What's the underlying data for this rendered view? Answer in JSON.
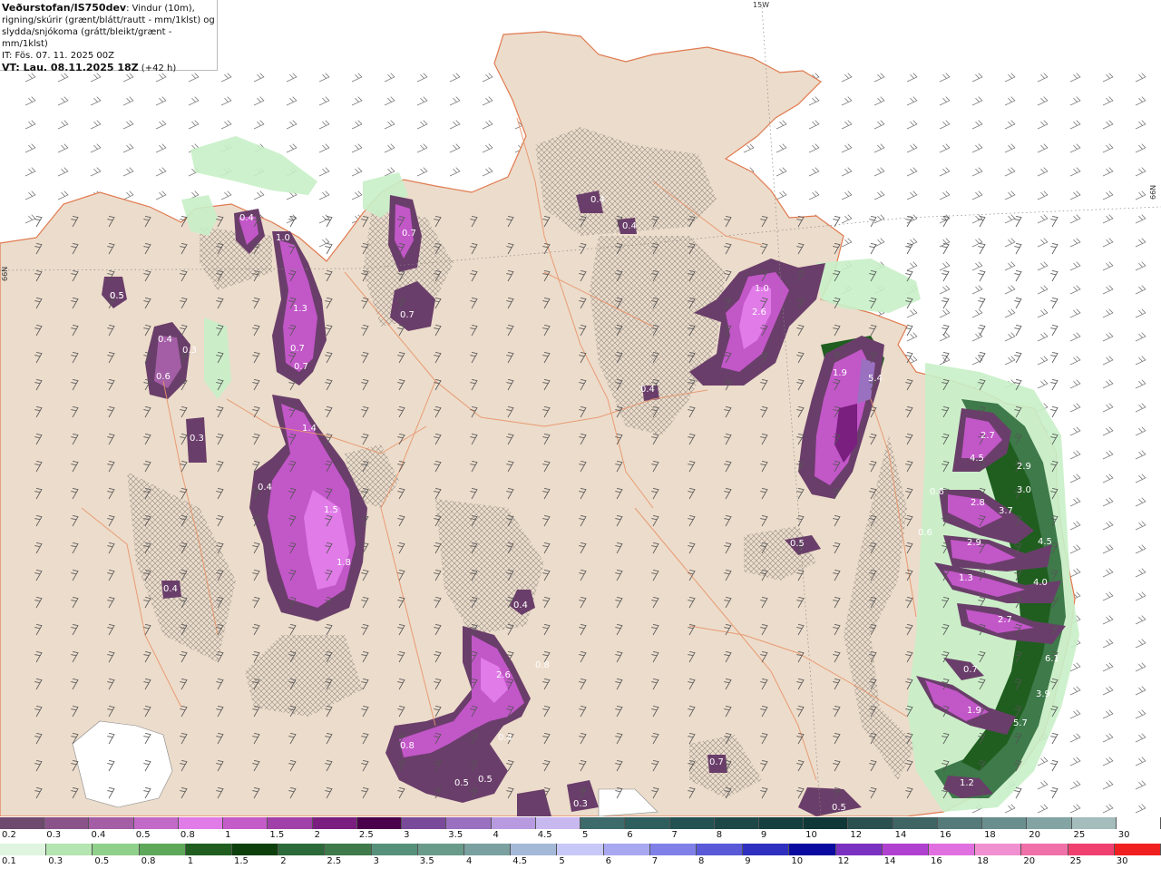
{
  "header": {
    "source": "Veðurstofan/IS750dev",
    "line1_rest": ": Vindur (10m),",
    "line2": "rigning/skúrir (grænt/blátt/rautt - mm/1klst) og",
    "line3": "slydda/snjókoma (grátt/bleikt/grænt - mm/1klst)",
    "it": "IT: Fös. 07. 11. 2025 00Z",
    "vt": "VT: Lau. 08.11.2025 18Z",
    "vt_offset": " (+42 h)"
  },
  "graticule": {
    "top_lon": "15W",
    "right_lat": "66N",
    "left_lat": "66N"
  },
  "colors": {
    "land": "#ecdccb",
    "sea": "#ffffff",
    "roads": "#e8956a",
    "snow_purple": "#c257c8",
    "snow_dark": "#6a3e6a",
    "rain_green": "#2f6a3a",
    "light_green": "#c8f0c8"
  },
  "precip_labels": [
    {
      "id": "l1",
      "text": "0.4"
    },
    {
      "id": "l2",
      "text": "0.4"
    },
    {
      "id": "l3",
      "text": "1.0"
    },
    {
      "id": "l4",
      "text": "2.6"
    },
    {
      "id": "l5",
      "text": "1.9"
    },
    {
      "id": "l6",
      "text": "5.4"
    },
    {
      "id": "l7",
      "text": "2.7"
    },
    {
      "id": "l8",
      "text": "4.5"
    },
    {
      "id": "l9",
      "text": "2.9"
    },
    {
      "id": "l10",
      "text": "3.0"
    },
    {
      "id": "l11",
      "text": "2.8"
    },
    {
      "id": "l12",
      "text": "3.7"
    },
    {
      "id": "l13",
      "text": "2.9"
    },
    {
      "id": "l14",
      "text": "4.5"
    },
    {
      "id": "l15",
      "text": "1.3"
    },
    {
      "id": "l16",
      "text": "4.0"
    },
    {
      "id": "l17",
      "text": "2.7"
    },
    {
      "id": "l18",
      "text": "6.1"
    },
    {
      "id": "l19",
      "text": "0.7"
    },
    {
      "id": "l20",
      "text": "1.9"
    },
    {
      "id": "l21",
      "text": "3.9"
    },
    {
      "id": "l22",
      "text": "5.7"
    },
    {
      "id": "l23",
      "text": "1.2"
    },
    {
      "id": "l24",
      "text": "0.5"
    },
    {
      "id": "l25",
      "text": "0.4"
    },
    {
      "id": "l26",
      "text": "2.6"
    },
    {
      "id": "l27",
      "text": "0.4"
    },
    {
      "id": "l28",
      "text": "0.8"
    },
    {
      "id": "l29",
      "text": "0.5"
    },
    {
      "id": "l30",
      "text": "0.5"
    },
    {
      "id": "l31",
      "text": "0.3"
    },
    {
      "id": "l32",
      "text": "0.7"
    },
    {
      "id": "l33",
      "text": "0.5"
    },
    {
      "id": "l34",
      "text": "1.4"
    },
    {
      "id": "l35",
      "text": "0.4"
    },
    {
      "id": "l36",
      "text": "1.5"
    },
    {
      "id": "l37",
      "text": "1.8"
    },
    {
      "id": "l38",
      "text": "0.4"
    },
    {
      "id": "l39",
      "text": "1.3"
    },
    {
      "id": "l40",
      "text": "0.7"
    },
    {
      "id": "l41",
      "text": "0.7"
    },
    {
      "id": "l42",
      "text": "1.0"
    },
    {
      "id": "l43",
      "text": "0.7"
    },
    {
      "id": "l44",
      "text": "0.7"
    },
    {
      "id": "l45",
      "text": "0.5"
    },
    {
      "id": "l46",
      "text": "0.4"
    },
    {
      "id": "l47",
      "text": "0.3"
    },
    {
      "id": "l48",
      "text": "0.6"
    },
    {
      "id": "l49",
      "text": "0.3"
    },
    {
      "id": "l50",
      "text": "0.5"
    },
    {
      "id": "l51",
      "text": "0.4"
    },
    {
      "id": "l52",
      "text": "0.8"
    },
    {
      "id": "l53",
      "text": "0.6"
    },
    {
      "id": "l54",
      "text": "0.6"
    },
    {
      "id": "l55",
      "text": "0.4"
    }
  ],
  "legend_snow": {
    "labels": [
      "0.2",
      "0.3",
      "0.4",
      "0.5",
      "0.8",
      "1",
      "1.5",
      "2",
      "2.5",
      "3",
      "3.5",
      "4",
      "4.5",
      "5",
      "6",
      "7",
      "8",
      "9",
      "10",
      "12",
      "14",
      "16",
      "18",
      "20",
      "25",
      "30"
    ],
    "colors": [
      "#6e4a6e",
      "#8a548a",
      "#a35ea5",
      "#c26ac8",
      "#e07be8",
      "#c45cc8",
      "#a040a8",
      "#7a1e80",
      "#4a004a",
      "#7a4a9a",
      "#9a70c0",
      "#b89ae0",
      "#c8b8f0",
      "#3d6a6a",
      "#2f5e5e",
      "#245252",
      "#1e4848",
      "#164040",
      "#103838",
      "#2a5050",
      "#3e6464",
      "#547a7a",
      "#6a8e8e",
      "#84a4a4",
      "#a4bcbc",
      "#ffffff"
    ]
  },
  "legend_rain": {
    "labels": [
      "0.1",
      "0.3",
      "0.5",
      "0.8",
      "1",
      "1.5",
      "2",
      "2.5",
      "3",
      "3.5",
      "4",
      "4.5",
      "5",
      "6",
      "7",
      "8",
      "9",
      "10",
      "12",
      "14",
      "16",
      "18",
      "20",
      "25",
      "30"
    ],
    "colors": [
      "#dff5df",
      "#b5e5b0",
      "#8fd08a",
      "#5ea85a",
      "#1f5e1f",
      "#0e400e",
      "#2c6a3a",
      "#3e7a4a",
      "#56907a",
      "#6a9a8a",
      "#7aa0a0",
      "#a4b8d8",
      "#c8c8f8",
      "#a8a8f0",
      "#8080e8",
      "#5a5ad8",
      "#3030c0",
      "#0a0aa0",
      "#7a30c0",
      "#b040d0",
      "#e070e0",
      "#f090d0",
      "#f070a8",
      "#f04070",
      "#f02020"
    ]
  }
}
